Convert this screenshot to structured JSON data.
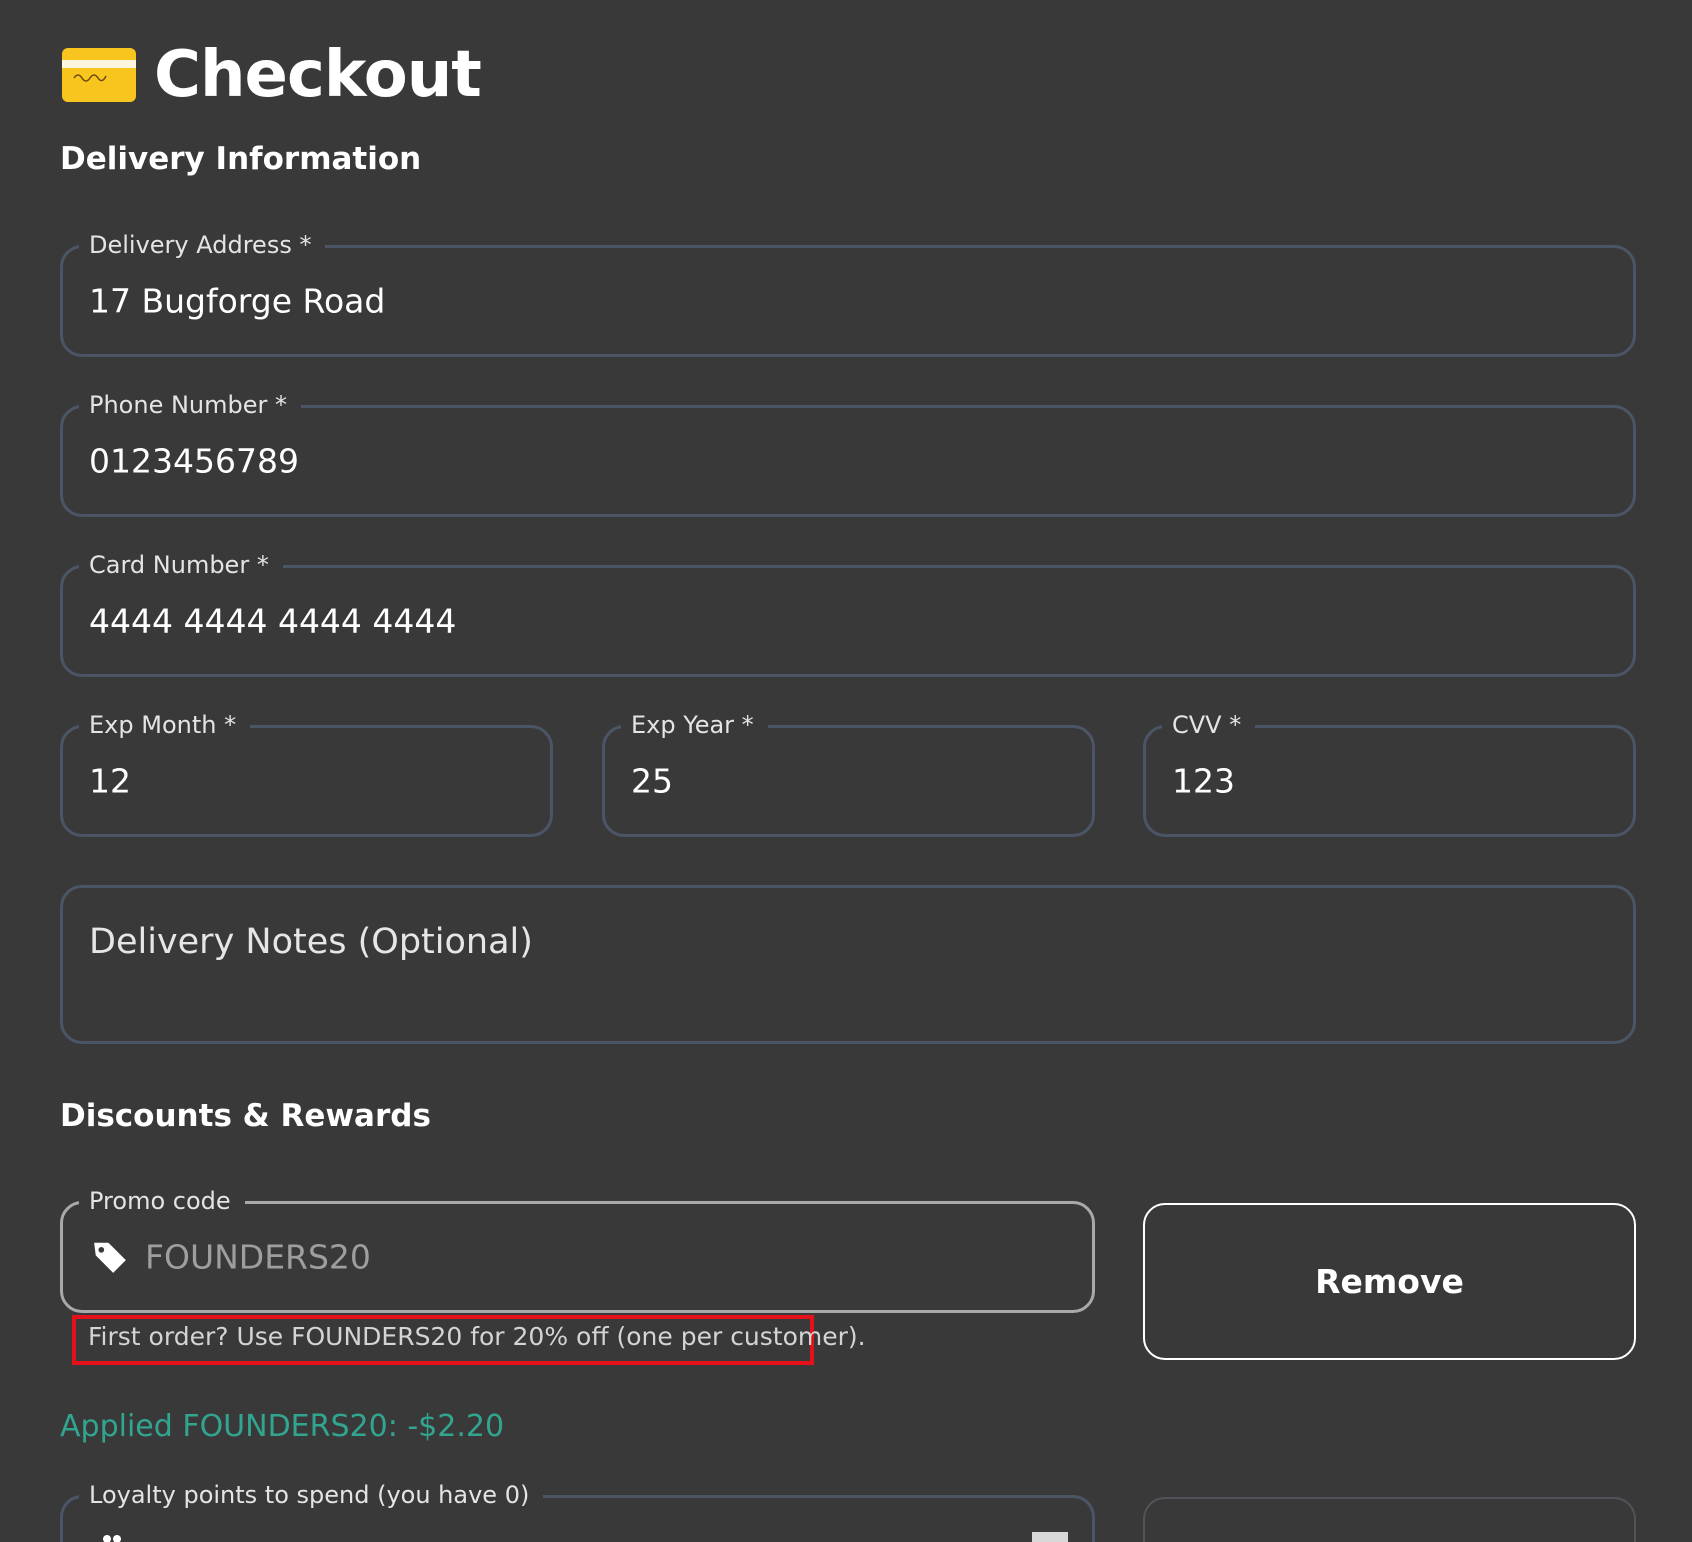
{
  "page": {
    "title": "Checkout",
    "title_icon": "credit-card-icon"
  },
  "delivery": {
    "heading": "Delivery Information",
    "address": {
      "label": "Delivery Address *",
      "value": "17 Bugforge Road"
    },
    "phone": {
      "label": "Phone Number *",
      "value": "0123456789"
    },
    "card": {
      "label": "Card Number *",
      "value": "4444 4444 4444 4444"
    },
    "exp_month": {
      "label": "Exp Month *",
      "value": "12"
    },
    "exp_year": {
      "label": "Exp Year *",
      "value": "25"
    },
    "cvv": {
      "label": "CVV *",
      "value": "123"
    },
    "notes": {
      "placeholder": "Delivery Notes (Optional)",
      "value": ""
    }
  },
  "discounts": {
    "heading": "Discounts & Rewards",
    "promo": {
      "label": "Promo code",
      "value": "FOUNDERS20",
      "icon": "tag-icon",
      "helper": "First order? Use FOUNDERS20 for 20% off (one per customer).",
      "remove_label": "Remove"
    },
    "applied": "Applied FOUNDERS20: -$2.20",
    "loyalty": {
      "label": "Loyalty points to spend (you have 0)"
    }
  },
  "colors": {
    "background": "#3a393a",
    "field_border": "#4b5566",
    "success": "#31a58f",
    "highlight_box": "#e6101a",
    "card_icon": "#f7c51e"
  }
}
